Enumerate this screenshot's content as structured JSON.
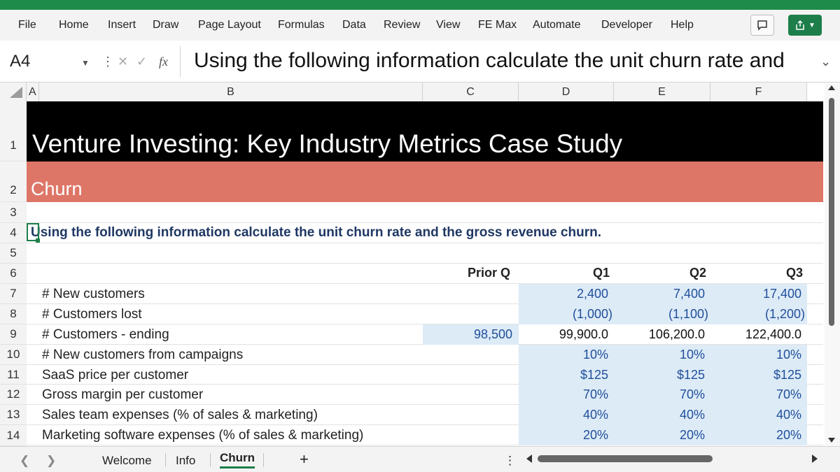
{
  "colors": {
    "accent": "#1e8b4a",
    "header_band": "#000000",
    "section_band": "#de7668",
    "input_fill": "#ddebf7",
    "input_text": "#1f4e9a"
  },
  "ribbon": {
    "tabs": [
      "File",
      "Home",
      "Insert",
      "Draw",
      "Page Layout",
      "Formulas",
      "Data",
      "Review",
      "View",
      "FE Max",
      "Automate",
      "Developer",
      "Help"
    ]
  },
  "formula_bar": {
    "name_box": "A4",
    "fx": "fx",
    "content": "Using the following information calculate the unit churn rate and"
  },
  "columns": [
    "A",
    "B",
    "C",
    "D",
    "E",
    "F"
  ],
  "rows": [
    "1",
    "2",
    "3",
    "4",
    "5",
    "6",
    "7",
    "8",
    "9",
    "10",
    "11",
    "12",
    "13",
    "14"
  ],
  "sheet": {
    "title": "Venture Investing: Key Industry Metrics Case Study",
    "section": "Churn",
    "instruction": "Using the following information calculate the unit churn rate and the gross revenue churn.",
    "headers": {
      "prior": "Prior Q",
      "q1": "Q1",
      "q2": "Q2",
      "q3": "Q3"
    },
    "items": [
      {
        "label": "# New customers",
        "prior": "",
        "q1": "2,400",
        "q2": "7,400",
        "q3": "17,400"
      },
      {
        "label": "# Customers lost",
        "prior": "",
        "q1": "(1,000)",
        "q2": "(1,100)",
        "q3": "(1,200)"
      },
      {
        "label": "# Customers - ending",
        "prior": "98,500",
        "q1": "99,900.0",
        "q2": "106,200.0",
        "q3": "122,400.0"
      },
      {
        "label": "# New customers from campaigns",
        "prior": "",
        "q1": "10%",
        "q2": "10%",
        "q3": "10%"
      },
      {
        "label": "SaaS price per customer",
        "prior": "",
        "q1": "$125",
        "q2": "$125",
        "q3": "$125"
      },
      {
        "label": "Gross margin per customer",
        "prior": "",
        "q1": "70%",
        "q2": "70%",
        "q3": "70%"
      },
      {
        "label": "Sales team expenses (% of sales & marketing)",
        "prior": "",
        "q1": "40%",
        "q2": "40%",
        "q3": "40%"
      },
      {
        "label": "Marketing software expenses (% of sales & marketing)",
        "prior": "",
        "q1": "20%",
        "q2": "20%",
        "q3": "20%"
      }
    ]
  },
  "sheet_tabs": {
    "tabs": [
      "Welcome",
      "Info",
      "Churn"
    ],
    "active": "Churn",
    "add": "+",
    "more": "⋮"
  }
}
